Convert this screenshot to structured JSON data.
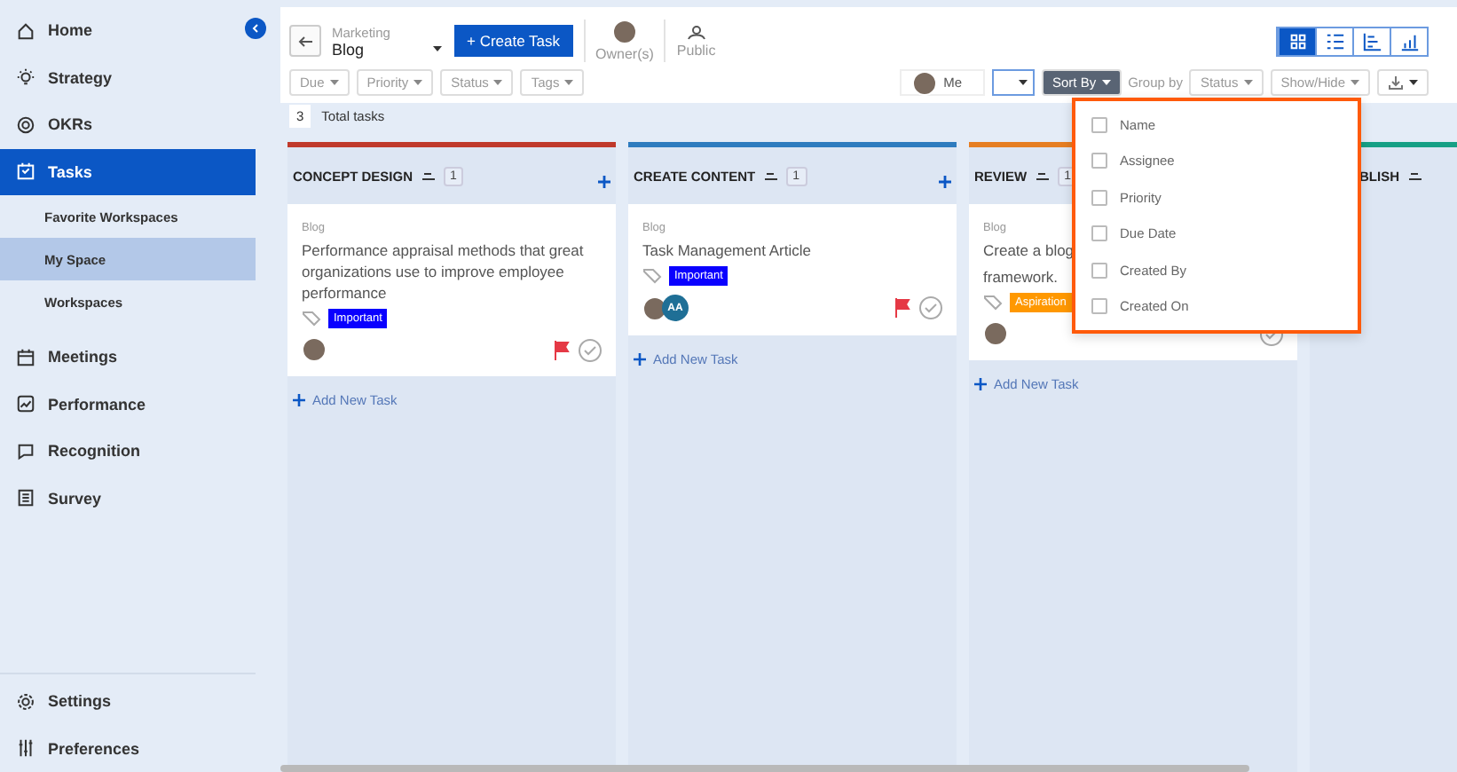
{
  "sidebar": {
    "items": [
      {
        "label": "Home",
        "selected": false
      },
      {
        "label": "Strategy",
        "selected": false
      },
      {
        "label": "OKRs",
        "selected": false
      },
      {
        "label": "Tasks",
        "selected": true,
        "children": [
          {
            "label": "Favorite Workspaces",
            "selected": false
          },
          {
            "label": "My Space",
            "selected": true
          },
          {
            "label": "Workspaces",
            "selected": false
          }
        ]
      },
      {
        "label": "Meetings",
        "selected": false
      },
      {
        "label": "Performance",
        "selected": false
      },
      {
        "label": "Recognition",
        "selected": false
      },
      {
        "label": "Survey",
        "selected": false
      }
    ],
    "bottom": [
      {
        "label": "Settings"
      },
      {
        "label": "Preferences"
      }
    ]
  },
  "header": {
    "workspace_label": "Marketing",
    "workspace": "Blog",
    "create_button": "+ Create Task",
    "owner_label": "Owner(s)",
    "visibility": "Public",
    "filters": [
      "Due",
      "Priority",
      "Status",
      "Tags"
    ],
    "views": [
      {
        "selected": true
      },
      {
        "selected": false
      },
      {
        "selected": false
      },
      {
        "selected": false
      }
    ],
    "me": "Me",
    "sort_button": "Sort By",
    "group_label": "Group by",
    "group_value": "Status",
    "show_hide": "Show/Hide"
  },
  "total": {
    "count": "3",
    "label": "Total tasks"
  },
  "columns": [
    {
      "title": "CONCEPT DESIGN",
      "count": "1",
      "color": "#c0392b",
      "add_icon": true,
      "add_label": "Add New Task",
      "cards": [
        {
          "project": "Blog",
          "title_lines": [
            "Performance appraisal methods that great organizations use to improve employee performance"
          ],
          "tag": {
            "label": "Important",
            "color": "#0a00ff"
          },
          "assignees": [
            {
              "kind": "photo"
            }
          ],
          "flag": true
        }
      ]
    },
    {
      "title": "CREATE CONTENT",
      "count": "1",
      "color": "#2e7cbf",
      "add_icon": true,
      "add_label": "Add New Task",
      "cards": [
        {
          "project": "Blog",
          "title_lines": [
            "Task Management Article"
          ],
          "tag": {
            "label": "Important",
            "color": "#0a00ff"
          },
          "assignees": [
            {
              "kind": "photo"
            },
            {
              "kind": "initials",
              "initials": "AA"
            }
          ],
          "flag": true
        }
      ]
    },
    {
      "title": "REVIEW",
      "count": "1",
      "color": "#e67e22",
      "add_label": "Add New Task",
      "cards": [
        {
          "project": "Blog",
          "title_lines": [
            "Create a blog",
            "framework."
          ],
          "tag": {
            "label": "Aspiration",
            "color": "#ff9800"
          },
          "assignees": [
            {
              "kind": "photo"
            }
          ],
          "flag": false
        }
      ]
    },
    {
      "title": "BLISH",
      "color": "#16a085"
    }
  ],
  "sort_menu": {
    "options": [
      {
        "label": "Name",
        "checked": false
      },
      {
        "label": "Assignee",
        "checked": false
      },
      {
        "label": "Priority",
        "checked": false
      },
      {
        "label": "Due Date",
        "checked": false
      },
      {
        "label": "Created By",
        "checked": false
      },
      {
        "label": "Created On",
        "checked": false
      }
    ]
  }
}
